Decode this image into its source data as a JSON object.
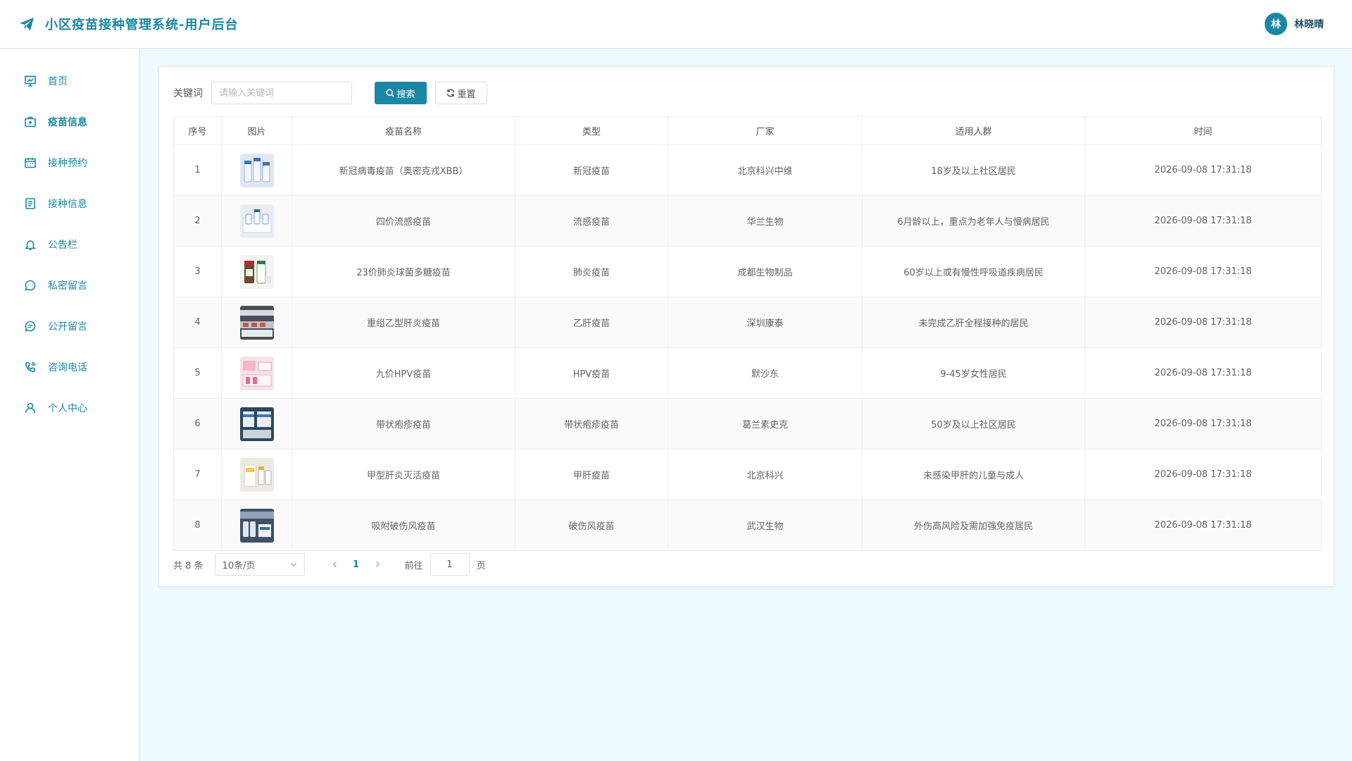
{
  "app": {
    "title": "小区疫苗接种管理系统-用户后台",
    "user_avatar_char": "林",
    "user_name": "林晓晴",
    "accent_color": "#1b86a4"
  },
  "sidebar": {
    "items": [
      {
        "label": "首页",
        "icon": "presentation-icon"
      },
      {
        "label": "疫苗信息",
        "icon": "medical-kit-icon",
        "active": true
      },
      {
        "label": "接种预约",
        "icon": "calendar-icon"
      },
      {
        "label": "接种信息",
        "icon": "document-icon"
      },
      {
        "label": "公告栏",
        "icon": "bell-icon"
      },
      {
        "label": "私密留言",
        "icon": "chat-dots-icon"
      },
      {
        "label": "公开留言",
        "icon": "chat-lines-icon"
      },
      {
        "label": "咨询电话",
        "icon": "phone-icon"
      },
      {
        "label": "个人中心",
        "icon": "user-icon"
      }
    ]
  },
  "toolbar": {
    "keyword_label": "关键词",
    "keyword_placeholder": "请输入关键词",
    "keyword_value": "",
    "search_label": "搜索",
    "reset_label": "重置"
  },
  "table": {
    "columns": [
      "序号",
      "图片",
      "疫苗名称",
      "类型",
      "厂家",
      "适用人群",
      "时间"
    ],
    "rows": [
      {
        "no": "1",
        "name": "新冠病毒疫苗（奥密克戎XBB）",
        "type": "新冠疫苗",
        "maker": "北京科兴中维",
        "target": "18岁及以上社区居民",
        "time": "2026-09-08 17:31:18"
      },
      {
        "no": "2",
        "name": "四价流感疫苗",
        "type": "流感疫苗",
        "maker": "华兰生物",
        "target": "6月龄以上，重点为老年人与慢病居民",
        "time": "2026-09-08 17:31:18"
      },
      {
        "no": "3",
        "name": "23价肺炎球菌多糖疫苗",
        "type": "肺炎疫苗",
        "maker": "成都生物制品",
        "target": "60岁以上或有慢性呼吸道疾病居民",
        "time": "2026-09-08 17:31:18"
      },
      {
        "no": "4",
        "name": "重组乙型肝炎疫苗",
        "type": "乙肝疫苗",
        "maker": "深圳康泰",
        "target": "未完成乙肝全程接种的居民",
        "time": "2026-09-08 17:31:18"
      },
      {
        "no": "5",
        "name": "九价HPV疫苗",
        "type": "HPV疫苗",
        "maker": "默沙东",
        "target": "9-45岁女性居民",
        "time": "2026-09-08 17:31:18"
      },
      {
        "no": "6",
        "name": "带状疱疹疫苗",
        "type": "带状疱疹疫苗",
        "maker": "葛兰素史克",
        "target": "50岁及以上社区居民",
        "time": "2026-09-08 17:31:18"
      },
      {
        "no": "7",
        "name": "甲型肝炎灭活疫苗",
        "type": "甲肝疫苗",
        "maker": "北京科兴",
        "target": "未感染甲肝的儿童与成人",
        "time": "2026-09-08 17:31:18"
      },
      {
        "no": "8",
        "name": "吸附破伤风疫苗",
        "type": "破伤风疫苗",
        "maker": "武汉生物",
        "target": "外伤高风险及需加强免疫居民",
        "time": "2026-09-08 17:31:18"
      }
    ]
  },
  "pagination": {
    "total_text": "共 8 条",
    "page_size": "10条/页",
    "current_page": "1",
    "goto_label": "前往",
    "goto_value": "1",
    "page_suffix": "页"
  }
}
